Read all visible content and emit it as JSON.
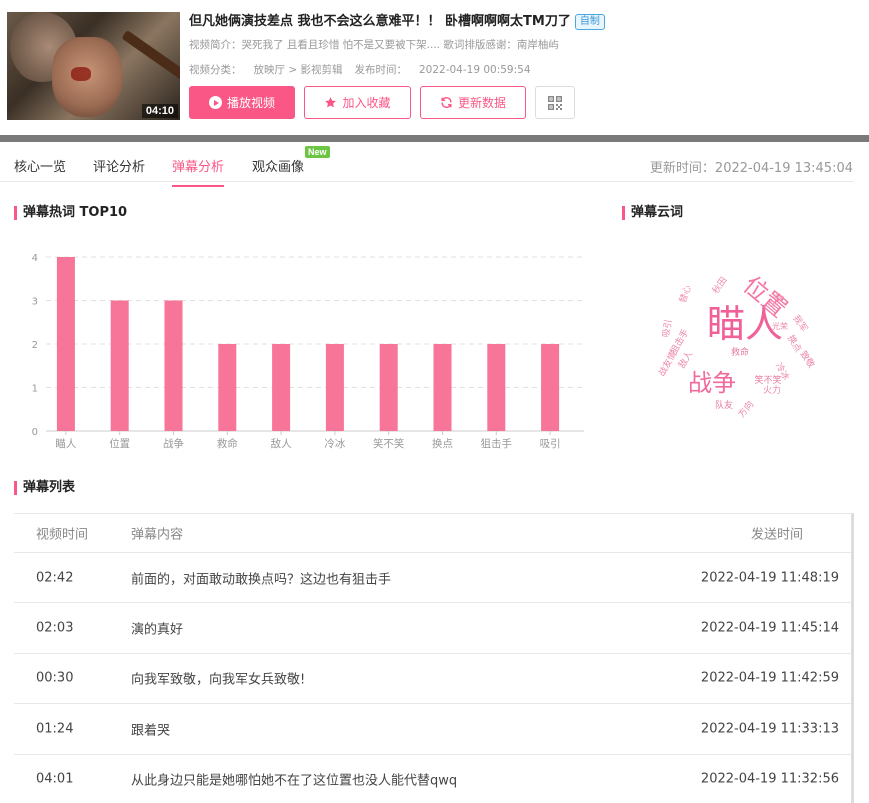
{
  "video": {
    "title": "但凡她俩演技差点 我也不会这么意难平！！ 卧槽啊啊啊太TM刀了",
    "badge": "自制",
    "duration": "04:10",
    "intro_label": "视频简介：",
    "intro_text": "哭死我了 且看且珍惜 怕不是又要被下架.... 歌词排版感谢：南岸柚屿",
    "category_label": "视频分类：",
    "category_value": "放映厅 > 影视剪辑",
    "publish_label": "发布时间：",
    "publish_value": "2022-04-19 00:59:54"
  },
  "actions": {
    "play": "播放视频",
    "favorite": "加入收藏",
    "update": "更新数据"
  },
  "tabs": [
    {
      "label": "核心一览"
    },
    {
      "label": "评论分析"
    },
    {
      "label": "弹幕分析"
    },
    {
      "label": "观众画像"
    }
  ],
  "new_badge": "New",
  "update_time": "更新时间：2022-04-19 13:45:04",
  "sections": {
    "top10": "弹幕热词 TOP10",
    "cloud": "弹幕云词",
    "list": "弹幕列表"
  },
  "colors": {
    "accent": "#fb5786",
    "bar": "#f77598"
  },
  "chart_data": {
    "type": "bar",
    "categories": [
      "瞄人",
      "位置",
      "战争",
      "救命",
      "敌人",
      "冷冰",
      "笑不笑",
      "换点",
      "狙击手",
      "吸引"
    ],
    "values": [
      4,
      3,
      3,
      2,
      2,
      2,
      2,
      2,
      2,
      2
    ],
    "yticks": [
      0,
      1,
      2,
      3,
      4
    ],
    "ylim": [
      0,
      4
    ],
    "grid": true
  },
  "word_cloud": [
    {
      "word": "瞄人",
      "weight": 4
    },
    {
      "word": "位置",
      "weight": 3
    },
    {
      "word": "战争",
      "weight": 3
    },
    {
      "word": "救命",
      "weight": 1
    },
    {
      "word": "敌人",
      "weight": 1
    },
    {
      "word": "冷冰",
      "weight": 1
    },
    {
      "word": "笑不笑",
      "weight": 1
    },
    {
      "word": "换点",
      "weight": 1
    },
    {
      "word": "狙击手",
      "weight": 1
    },
    {
      "word": "吸引",
      "weight": 1
    },
    {
      "word": "只能",
      "weight": 1
    },
    {
      "word": "我军",
      "weight": 1
    },
    {
      "word": "致敬",
      "weight": 1
    },
    {
      "word": "火力",
      "weight": 1
    },
    {
      "word": "队友",
      "weight": 1
    },
    {
      "word": "方向",
      "weight": 1
    },
    {
      "word": "战友情",
      "weight": 1
    },
    {
      "word": "秋田",
      "weight": 1
    },
    {
      "word": "替心",
      "weight": 1
    },
    {
      "word": "光荣",
      "weight": 1
    }
  ],
  "list": {
    "headers": [
      "视频时间",
      "弹幕内容",
      "发送时间"
    ],
    "rows": [
      {
        "time": "02:42",
        "content": "前面的，对面敢动敢换点吗？这边也有狙击手",
        "sent": "2022-04-19 11:48:19"
      },
      {
        "time": "02:03",
        "content": "演的真好",
        "sent": "2022-04-19 11:45:14"
      },
      {
        "time": "00:30",
        "content": "向我军致敬，向我军女兵致敬!",
        "sent": "2022-04-19 11:42:59"
      },
      {
        "time": "01:24",
        "content": "跟着哭",
        "sent": "2022-04-19 11:33:13"
      },
      {
        "time": "04:01",
        "content": "从此身边只能是她哪怕她不在了这位置也没人能代替qwq",
        "sent": "2022-04-19 11:32:56"
      }
    ]
  }
}
